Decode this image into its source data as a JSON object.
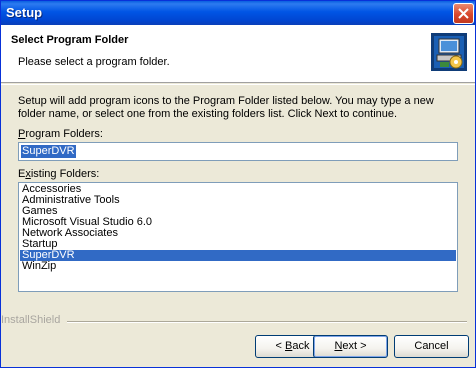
{
  "window": {
    "title": "Setup"
  },
  "header": {
    "title": "Select Program Folder",
    "subtitle": "Please select a program folder."
  },
  "body": {
    "description": "Setup will add program icons to the Program Folder listed below.  You may type a new folder name, or select one from the existing folders list.  Click Next to continue.",
    "program_folders_label_mnemonic": "P",
    "program_folders_label_rest": "rogram Folders:",
    "program_folder_value": "SuperDVR",
    "existing_folders_label_first": "E",
    "existing_folders_label_mnemonic": "x",
    "existing_folders_label_rest": "isting Folders:",
    "existing_folders": [
      "Accessories",
      "Administrative Tools",
      "Games",
      "Microsoft Visual Studio 6.0",
      "Network Associates",
      "Startup",
      "SuperDVR",
      "WinZip"
    ],
    "selected_folder_index": 6
  },
  "footer": {
    "brand": "InstallShield",
    "back_prefix": "< ",
    "back_mnemonic": "B",
    "back_rest": "ack",
    "next_mnemonic": "N",
    "next_rest": "ext >",
    "cancel_label": "Cancel"
  },
  "colors": {
    "titlebar": "#0055e5",
    "selection": "#316ac5",
    "close": "#d8472c"
  },
  "icons": [
    "close-icon",
    "setup-computer-icon"
  ]
}
